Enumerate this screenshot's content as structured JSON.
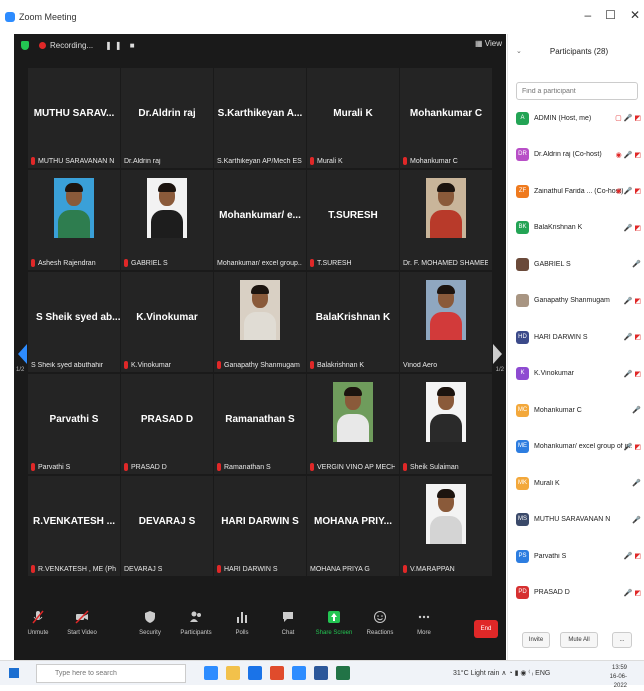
{
  "window": {
    "title": "Zoom Meeting",
    "controls": [
      "–",
      "☐",
      "✕"
    ]
  },
  "meeting": {
    "recording_label": "Recording...",
    "recording_controls": "❚❚ ■",
    "view_label": "View",
    "page_left": "1/2",
    "page_right": "1/2"
  },
  "tiles": [
    {
      "name": "MUTHU SARAV...",
      "label": "MUTHU SARAVANAN N",
      "muted": true,
      "photo": false
    },
    {
      "name": "Dr.Aldrin raj",
      "label": "Dr.Aldrin raj",
      "muted": false,
      "photo": false
    },
    {
      "name": "S.Karthikeyan A...",
      "label": "S.Karthikeyan AP/Mech ESEC",
      "muted": false,
      "photo": false
    },
    {
      "name": "Murali K",
      "label": "Murali K",
      "muted": true,
      "photo": false
    },
    {
      "name": "Mohankumar C",
      "label": "Mohankumar C",
      "muted": true,
      "photo": false
    },
    {
      "name": "",
      "label": "Ashesh Rajendran",
      "muted": true,
      "photo": true,
      "photo_bg": "#3aa0d8",
      "shirt": "#2e7d4f"
    },
    {
      "name": "",
      "label": "GABRIEL S",
      "muted": true,
      "photo": true,
      "photo_bg": "#f2f2f2",
      "shirt": "#1d1d1d"
    },
    {
      "name": "Mohankumar/ e...",
      "label": "Mohankumar/ excel group...",
      "muted": false,
      "photo": false
    },
    {
      "name": "T.SURESH",
      "label": "T.SURESH",
      "muted": true,
      "photo": false
    },
    {
      "name": "",
      "label": "Dr. F. MOHAMED SHAMEER",
      "muted": false,
      "photo": true,
      "photo_bg": "#c9b59a",
      "shirt": "#b83a2a"
    },
    {
      "name": "S Sheik syed ab...",
      "label": "S Sheik syed abuthahir",
      "muted": false,
      "photo": false,
      "left": true
    },
    {
      "name": "K.Vinokumar",
      "label": "K.Vinokumar",
      "muted": true,
      "photo": false
    },
    {
      "name": "",
      "label": "Ganapathy Shanmugam",
      "muted": true,
      "photo": true,
      "photo_bg": "#d9d0c4",
      "shirt": "#e0dcd4"
    },
    {
      "name": "BalaKrishnan K",
      "label": "Balakrishnan K",
      "muted": true,
      "photo": false
    },
    {
      "name": "",
      "label": "Vinod Aero",
      "muted": false,
      "photo": true,
      "photo_bg": "#8fa7c0",
      "shirt": "#d23a3a"
    },
    {
      "name": "Parvathi S",
      "label": "Parvathi S",
      "muted": true,
      "photo": false
    },
    {
      "name": "PRASAD D",
      "label": "PRASAD D",
      "muted": true,
      "photo": false
    },
    {
      "name": "Ramanathan S",
      "label": "Ramanathan S",
      "muted": true,
      "photo": false
    },
    {
      "name": "",
      "label": "VERGIN VINO AP MECH PS...",
      "muted": true,
      "photo": true,
      "photo_bg": "#6f9c5c",
      "shirt": "#e8e8e8"
    },
    {
      "name": "",
      "label": "Sheik Sulaiman",
      "muted": true,
      "photo": true,
      "photo_bg": "#f4f4f4",
      "shirt": "#2a2a2a"
    },
    {
      "name": "R.VENKATESH ...",
      "label": "R.VENKATESH , ME (PhD)",
      "muted": true,
      "photo": false
    },
    {
      "name": "DEVARAJ S",
      "label": "DEVARAJ S",
      "muted": false,
      "photo": false
    },
    {
      "name": "HARI DARWIN S",
      "label": "HARI DARWIN S",
      "muted": true,
      "photo": false
    },
    {
      "name": "MOHANA PRIY...",
      "label": "MOHANA PRIYA G",
      "muted": false,
      "photo": false
    },
    {
      "name": "",
      "label": "V.MARAPPAN",
      "muted": true,
      "photo": true,
      "photo_bg": "#f3f3f3",
      "shirt": "#d4d4d4"
    }
  ],
  "toolbar": {
    "unmute": "Unmute",
    "start_video": "Start Video",
    "security": "Security",
    "participants": "Participants",
    "participants_count": "28",
    "polls": "Polls",
    "chat": "Chat",
    "share_screen": "Share Screen",
    "reactions": "Reactions",
    "more": "More",
    "end": "End"
  },
  "panel": {
    "title": "Participants (28)",
    "search_placeholder": "Find a participant",
    "invite": "Invite",
    "mute_all": "Mute All",
    "more": "...",
    "participants": [
      {
        "initials": "A",
        "name": "ADMIN (Host, me)",
        "color": "#23a455",
        "icons": "▢ 🎤 ◩"
      },
      {
        "initials": "DR",
        "name": "Dr.Aldrin raj (Co-host)",
        "color": "#b84fc7",
        "icons": "◉ 🎤 ◩"
      },
      {
        "initials": "ZF",
        "name": "Zainathul Farida ... (Co-host)",
        "color": "#ef7a1e",
        "icons": "◉ 🎤 ◩"
      },
      {
        "initials": "BK",
        "name": "BalaKrishnan K",
        "color": "#23a455",
        "icons": "🎤 ◩"
      },
      {
        "initials": "",
        "name": "GABRIEL S",
        "color": "#6b4a3a",
        "icons": "🎤"
      },
      {
        "initials": "",
        "name": "Ganapathy Shanmugam",
        "color": "#a89582",
        "icons": "🎤 ◩"
      },
      {
        "initials": "HD",
        "name": "HARI DARWIN S",
        "color": "#3b4a8a",
        "icons": "🎤 ◩"
      },
      {
        "initials": "K",
        "name": "K.Vinokumar",
        "color": "#8e4bd1",
        "icons": "🎤 ◩"
      },
      {
        "initials": "MC",
        "name": "Mohankumar C",
        "color": "#f3a83b",
        "icons": "🎤"
      },
      {
        "initials": "ME",
        "name": "Mohankumar/ excel group of in...",
        "color": "#2d7de0",
        "icons": "🎤 ◩"
      },
      {
        "initials": "MK",
        "name": "Murali K",
        "color": "#f3a83b",
        "icons": "🎤"
      },
      {
        "initials": "MS",
        "name": "MUTHU SARAVANAN N",
        "color": "#3b4a6a",
        "icons": "🎤"
      },
      {
        "initials": "PS",
        "name": "Parvathi S",
        "color": "#2d7de0",
        "icons": "🎤 ◩"
      },
      {
        "initials": "PD",
        "name": "PRASAD D",
        "color": "#d63030",
        "icons": "🎤 ◩"
      }
    ]
  },
  "taskbar": {
    "search_placeholder": "Type here to search",
    "weather": "31°C Light rain",
    "tray": "∧ ◔ ▮ ◉ ⁽ ᵢ ENG",
    "time": "13:59",
    "date": "16-06-2022"
  }
}
